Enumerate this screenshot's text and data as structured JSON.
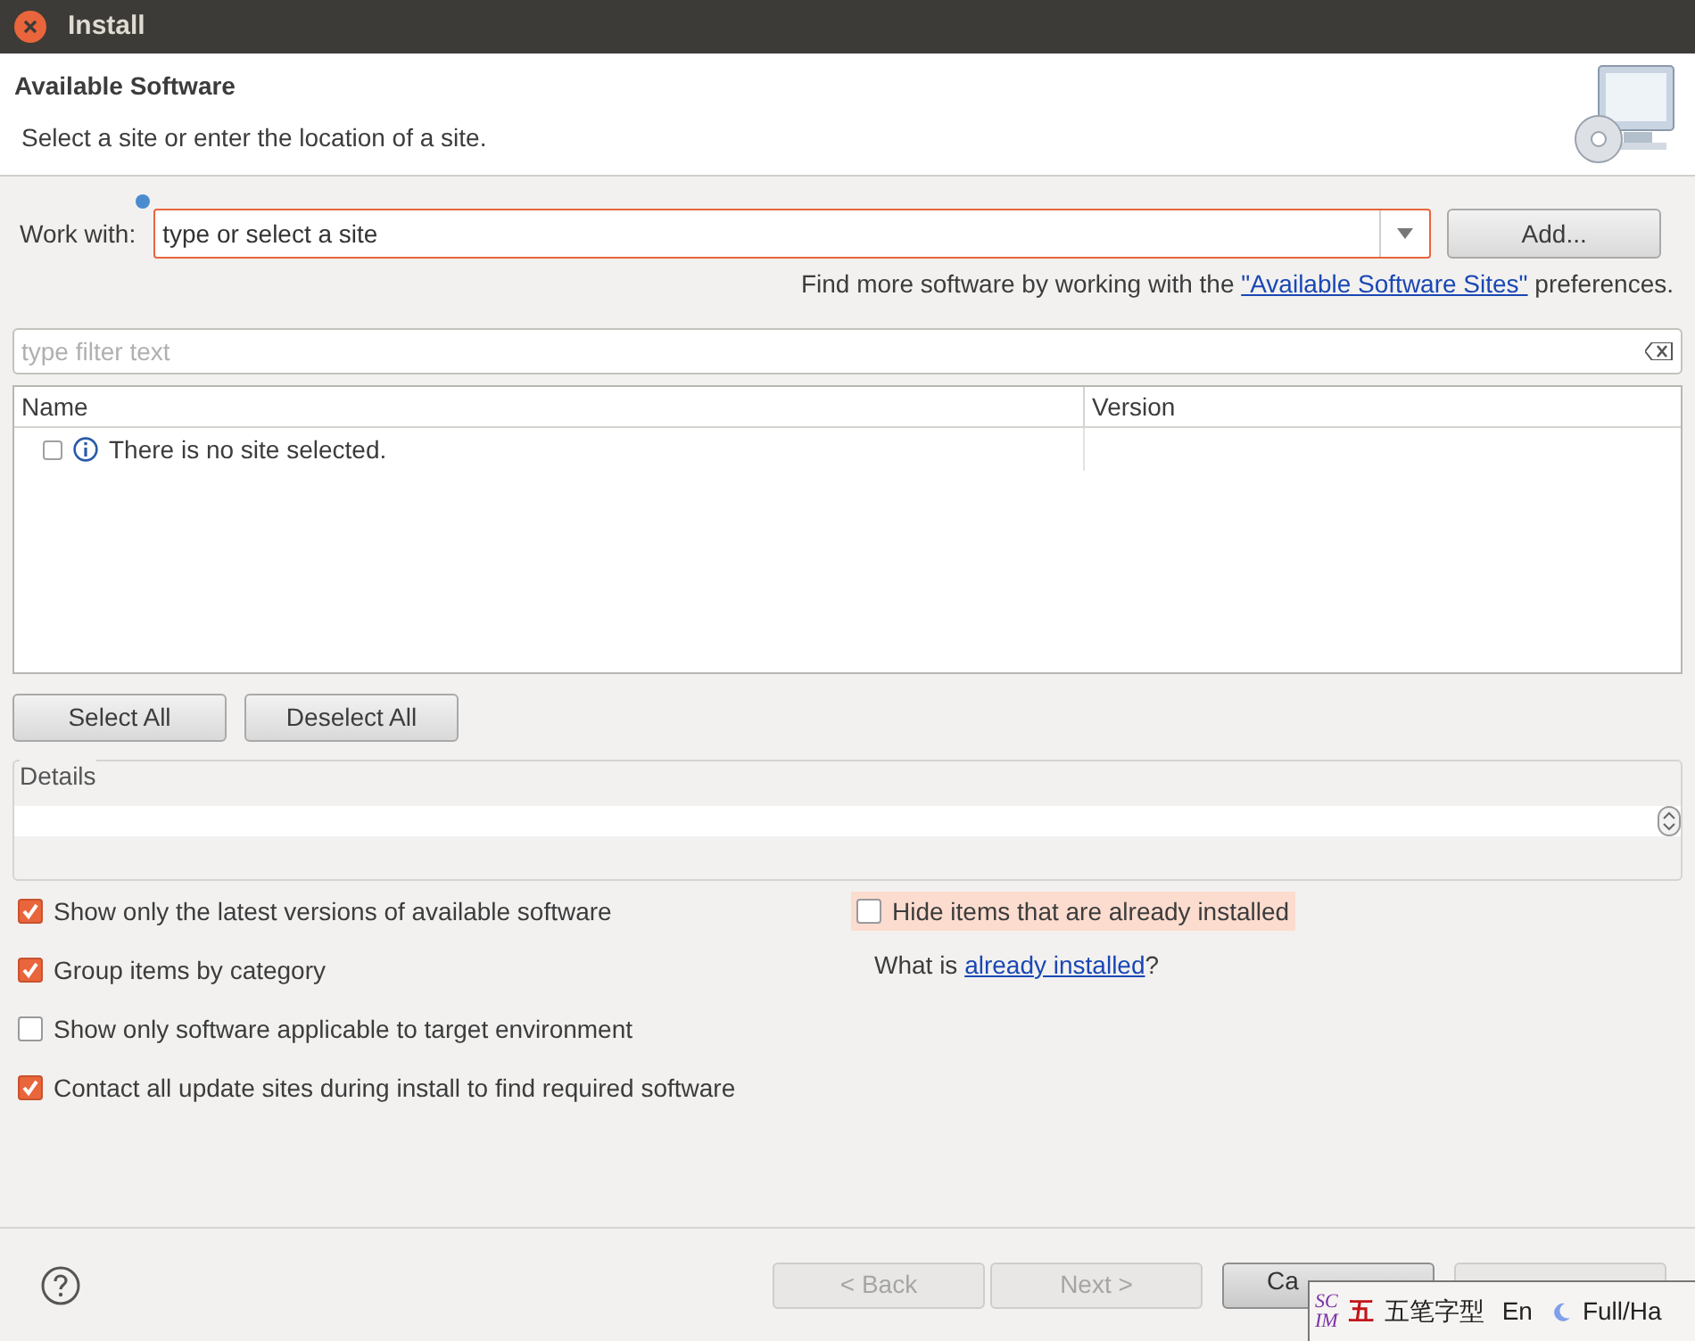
{
  "window": {
    "title": "Install"
  },
  "header": {
    "title": "Available Software",
    "subtitle": "Select a site or enter the location of a site."
  },
  "work_with": {
    "label": "Work with:",
    "value": "type or select a site",
    "button": "Add..."
  },
  "sites_note": {
    "prefix": "Find more software by working with the ",
    "link": "\"Available Software Sites\"",
    "suffix": " preferences."
  },
  "filter": {
    "placeholder": "type filter text"
  },
  "table": {
    "columns": [
      "Name",
      "Version"
    ],
    "rows": [
      {
        "name": "There is no site selected.",
        "checked": false
      }
    ]
  },
  "selection_buttons": [
    "Select All",
    "Deselect All"
  ],
  "details": {
    "label": "Details"
  },
  "options_left": [
    {
      "label": "Show only the latest versions of available software",
      "checked": true
    },
    {
      "label": "Group items by category",
      "checked": true
    },
    {
      "label": "Show only software applicable to target environment",
      "checked": false
    },
    {
      "label": "Contact all update sites during install to find required software",
      "checked": true
    }
  ],
  "option_right": {
    "label": "Hide items that are already installed",
    "checked": false,
    "hovered": true
  },
  "installed_note": {
    "prefix": "What is ",
    "link": "already installed",
    "suffix": "?"
  },
  "footer_buttons": [
    {
      "label": "< Back",
      "disabled": true
    },
    {
      "label": "Next >",
      "disabled": true
    },
    {
      "label": "Ca",
      "disabled": false
    },
    {
      "disabled": true
    }
  ],
  "ime_bar": {
    "logo_top": "SC",
    "logo_bottom": "IM",
    "mode_glyph": "五",
    "mode": "五笔字型",
    "language": "En",
    "width": "Full/Ha"
  }
}
